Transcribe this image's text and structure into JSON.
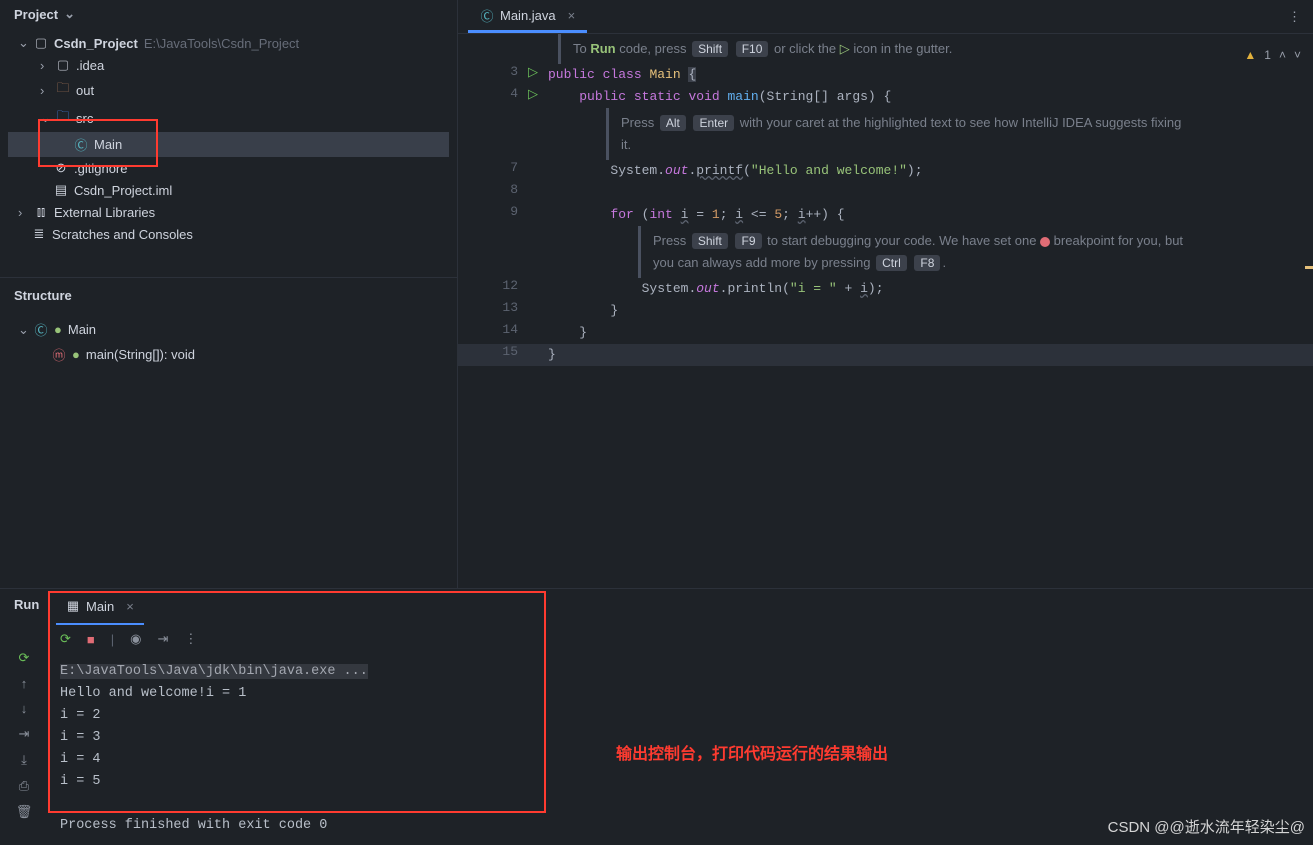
{
  "project": {
    "panel_title": "Project",
    "root": "Csdn_Project",
    "root_path": "E:\\JavaTools\\Csdn_Project",
    "items": {
      "idea": ".idea",
      "out": "out",
      "src": "src",
      "main_class": "Main",
      "gitignore": ".gitignore",
      "iml": "Csdn_Project.iml",
      "external": "External Libraries",
      "scratches": "Scratches and Consoles"
    }
  },
  "structure": {
    "title": "Structure",
    "class": "Main",
    "method": "main(String[]): void"
  },
  "editor": {
    "tab_name": "Main.java",
    "warning_count": "1",
    "hints": {
      "run": {
        "pre": "To ",
        "run": "Run",
        "mid": " code, press ",
        "k1": "Shift",
        "k2": "F10",
        "post": " or click the ",
        "post2": " icon in the gutter."
      },
      "alt": {
        "pre": "Press ",
        "k1": "Alt",
        "k2": "Enter",
        "post": " with your caret at the highlighted text to see how IntelliJ IDEA suggests fixing it."
      },
      "debug": {
        "pre": "Press ",
        "k1": "Shift",
        "k2": "F9",
        "mid": " to start debugging your code. We have set one ",
        "mid2": " breakpoint for you, but you can always add more by pressing ",
        "k3": "Ctrl",
        "k4": "F8",
        "end": "."
      }
    },
    "lines": {
      "l3": "3",
      "l4": "4",
      "l7": "7",
      "l8": "8",
      "l9": "9",
      "l12": "12",
      "l13": "13",
      "l14": "14",
      "l15": "15"
    },
    "code": {
      "public": "public",
      "class": "class",
      "Main": "Main",
      "static": "static",
      "void": "void",
      "main": "main",
      "args": "(String[] args) {",
      "System": "System",
      "dot": ".",
      "out": "out",
      "printf": "printf",
      "println": "println",
      "hello": "\"Hello and welcome!\"",
      "semiparen": ");",
      "for": "for",
      "int": "int",
      "i": "i",
      "eq": " = ",
      "one": "1",
      "le": " <= ",
      "five": "5",
      "ipp": "++) {",
      "ieq": "\"i = \"",
      "plus": " + ",
      "close13": "        }",
      "close14": "    }",
      "close15": "}"
    }
  },
  "run": {
    "panel_title": "Run",
    "tab_name": "Main",
    "output": {
      "cmd": "E:\\JavaTools\\Java\\jdk\\bin\\java.exe ...",
      "l1": "Hello and welcome!i = 1",
      "l2": "i = 2",
      "l3": "i = 3",
      "l4": "i = 4",
      "l5": "i = 5",
      "exit": "Process finished with exit code 0"
    }
  },
  "annotation": "输出控制台，打印代码运行的结果输出",
  "watermark": "CSDN @@逝水流年轻染尘@"
}
